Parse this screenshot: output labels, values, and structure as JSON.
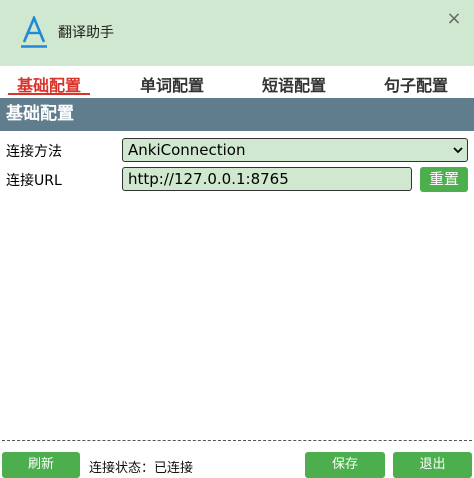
{
  "window": {
    "title": "翻译助手",
    "icon": "translate-a-icon",
    "icon_color": "#1f8bd6",
    "close_glyph": "×"
  },
  "tabs": [
    {
      "label": "基础配置",
      "active": true
    },
    {
      "label": "单词配置",
      "active": false
    },
    {
      "label": "短语配置",
      "active": false
    },
    {
      "label": "句子配置",
      "active": false
    }
  ],
  "section": {
    "title": "基础配置"
  },
  "form": {
    "connection_method_label": "连接方法",
    "connection_method_value": "AnkiConnection",
    "connection_url_label": "连接URL",
    "connection_url_value": "http://127.0.0.1:8765",
    "reset_label": "重置"
  },
  "footer": {
    "refresh_label": "刷新",
    "status_text": "连接状态：已连接",
    "save_label": "保存",
    "exit_label": "退出"
  },
  "colors": {
    "titlebar_bg": "#cfe8cf",
    "section_bg": "#5f7d8c",
    "active_tab": "#d9342b",
    "button_green": "#4cae4c",
    "field_bg": "#cfe8cf"
  }
}
